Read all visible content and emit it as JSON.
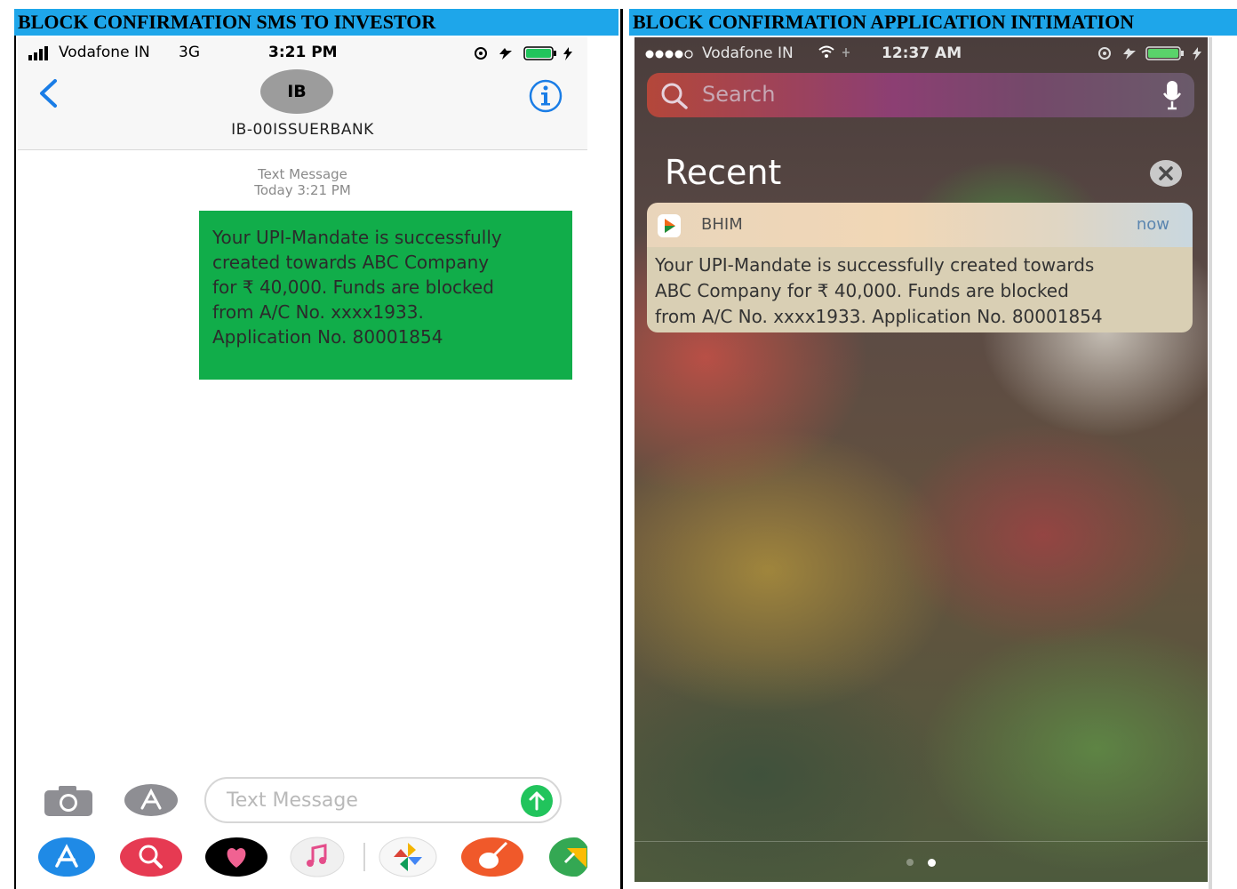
{
  "headers": {
    "left": "BLOCK CONFIRMATION SMS TO INVESTOR",
    "right": "BLOCK CONFIRMATION APPLICATION INTIMATION"
  },
  "left_phone": {
    "status_bar": {
      "carrier": "Vodafone IN",
      "network": "3G",
      "time": "3:21 PM"
    },
    "contact": {
      "initials": "IB",
      "sender_id": "IB-00ISSUERBANK"
    },
    "message_meta": {
      "type": "Text Message",
      "timestamp": "Today 3:21 PM"
    },
    "message_lines": [
      "Your UPI-Mandate is successfully",
      "created towards ABC Company",
      "for ₹ 40,000. Funds are blocked",
      "from A/C No. xxxx1933.",
      "Application No. 80001854"
    ],
    "compose_placeholder": "Text Message",
    "colors": {
      "bubble": "#11ad4a",
      "accent": "#1a7de6",
      "send": "#21c45c"
    }
  },
  "right_phone": {
    "status_bar": {
      "carrier": "Vodafone IN",
      "time": "12:37 AM"
    },
    "search_placeholder": "Search",
    "section_title": "Recent",
    "notification": {
      "app": "BHIM",
      "time": "now",
      "lines": [
        "Your UPI-Mandate is successfully created towards",
        "ABC Company for ₹ 40,000. Funds are blocked",
        "from A/C No. xxxx1933. Application No. 80001854"
      ]
    }
  }
}
